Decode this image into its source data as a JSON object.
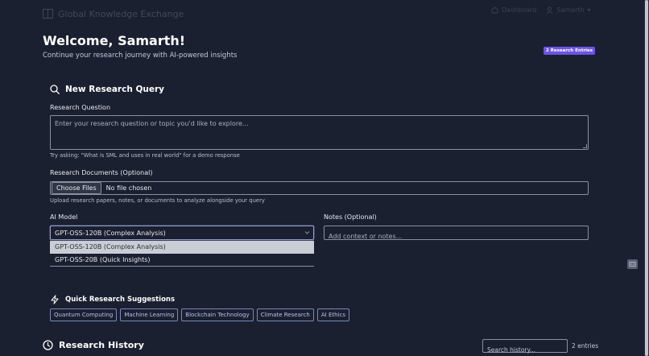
{
  "nav": {
    "brand": "Global Knowledge Exchange",
    "link_1": "Dashboard",
    "user_menu": "Samarth"
  },
  "header": {
    "welcome": "Welcome, Samarth!",
    "subtitle": "Continue your research journey with AI-powered insights",
    "entries_badge": "2 Research Entries"
  },
  "query": {
    "title": "New Research Query",
    "question_label": "Research Question",
    "question_placeholder": "Enter your research question or topic you'd like to explore...",
    "question_hint": "Try asking: \"What is SML and uses in real world\" for a demo response",
    "documents_label": "Research Documents (Optional)",
    "choose_files": "Choose Files",
    "no_file": "No file chosen",
    "documents_hint": "Upload research papers, notes, or documents to analyze alongside your query",
    "model_label": "AI Model",
    "model_selected": "GPT-OSS-120B (Complex Analysis)",
    "model_options": [
      "GPT-OSS-120B (Complex Analysis)",
      "GPT-OSS-20B (Quick Insights)"
    ],
    "notes_label": "Notes (Optional)",
    "notes_placeholder": "Add context or notes..."
  },
  "suggestions": {
    "title": "Quick Research Suggestions",
    "items": [
      "Quantum Computing",
      "Machine Learning",
      "Blockchain Technology",
      "Climate Research",
      "AI Ethics"
    ]
  },
  "history": {
    "title": "Research History",
    "search_placeholder": "Search history...",
    "count": "2 entries"
  },
  "colors": {
    "background": "#1a2030",
    "accent": "#6d54e6",
    "chip_border": "#7e86b8"
  }
}
